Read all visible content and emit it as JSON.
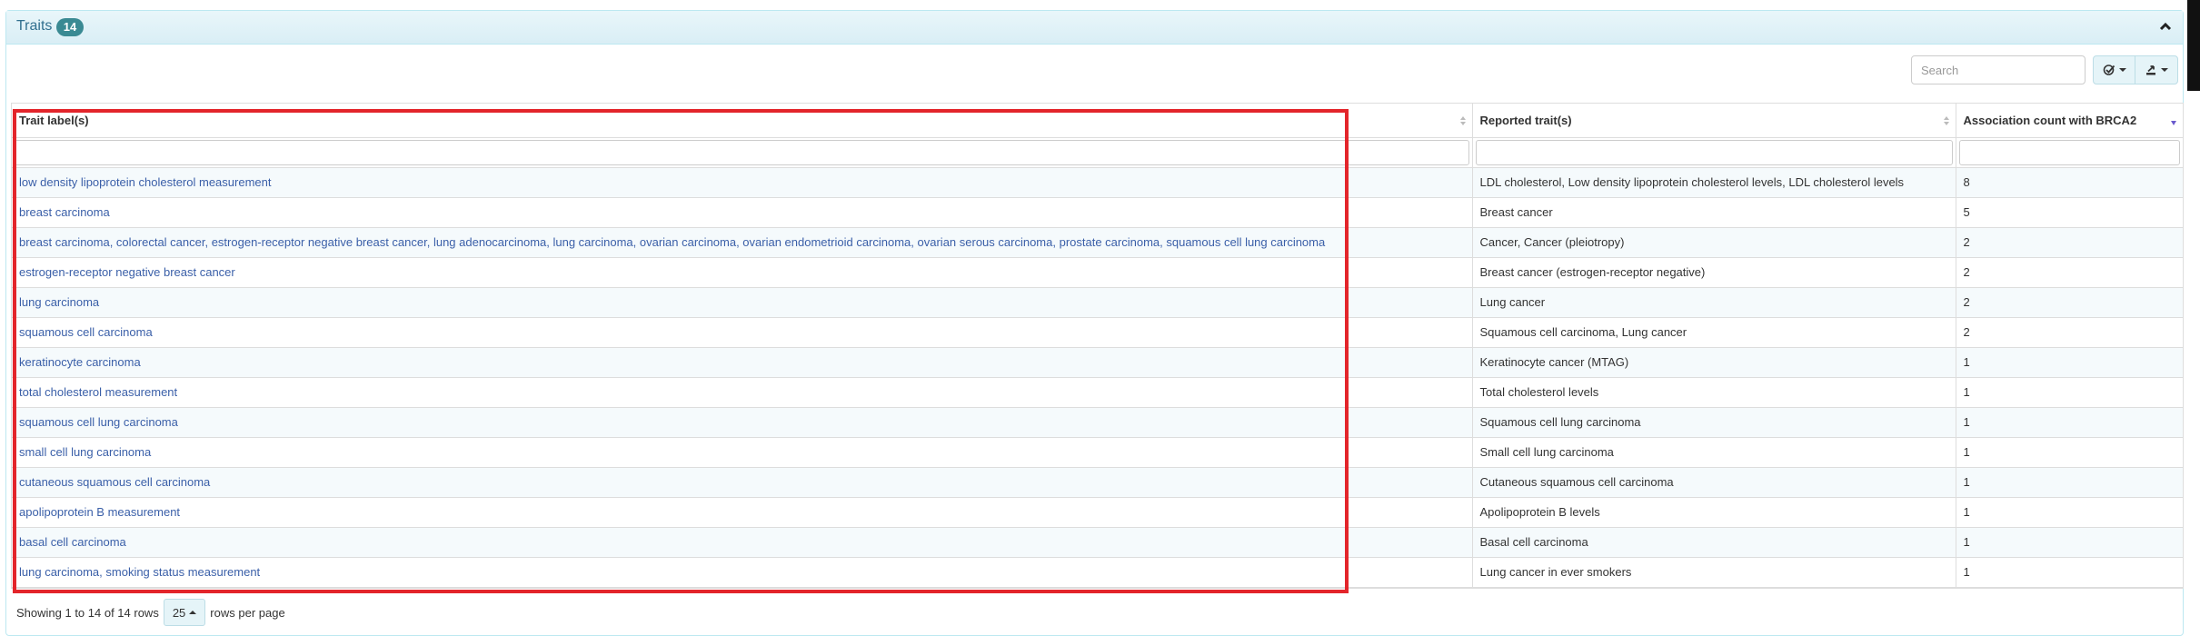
{
  "panel": {
    "title": "Traits",
    "count_badge": "14"
  },
  "toolbar": {
    "search_placeholder": "Search",
    "columns_icon": "columns-toggle-icon",
    "export_icon": "export-icon"
  },
  "table": {
    "columns": [
      "Trait label(s)",
      "Reported trait(s)",
      "Association count with BRCA2"
    ],
    "rows": [
      {
        "trait": "low density lipoprotein cholesterol measurement",
        "reported": "LDL cholesterol, Low density lipoprotein cholesterol levels, LDL cholesterol levels",
        "count": "8"
      },
      {
        "trait": "breast carcinoma",
        "reported": "Breast cancer",
        "count": "5"
      },
      {
        "trait": "breast carcinoma, colorectal cancer, estrogen-receptor negative breast cancer, lung adenocarcinoma, lung carcinoma, ovarian carcinoma, ovarian endometrioid carcinoma, ovarian serous carcinoma, prostate carcinoma, squamous cell lung carcinoma",
        "reported": "Cancer, Cancer (pleiotropy)",
        "count": "2"
      },
      {
        "trait": "estrogen-receptor negative breast cancer",
        "reported": "Breast cancer (estrogen-receptor negative)",
        "count": "2"
      },
      {
        "trait": "lung carcinoma",
        "reported": "Lung cancer",
        "count": "2"
      },
      {
        "trait": "squamous cell carcinoma",
        "reported": "Squamous cell carcinoma, Lung cancer",
        "count": "2"
      },
      {
        "trait": "keratinocyte carcinoma",
        "reported": "Keratinocyte cancer (MTAG)",
        "count": "1"
      },
      {
        "trait": "total cholesterol measurement",
        "reported": "Total cholesterol levels",
        "count": "1"
      },
      {
        "trait": "squamous cell lung carcinoma",
        "reported": "Squamous cell lung carcinoma",
        "count": "1"
      },
      {
        "trait": "small cell lung carcinoma",
        "reported": "Small cell lung carcinoma",
        "count": "1"
      },
      {
        "trait": "cutaneous squamous cell carcinoma",
        "reported": "Cutaneous squamous cell carcinoma",
        "count": "1"
      },
      {
        "trait": "apolipoprotein B measurement",
        "reported": "Apolipoprotein B levels",
        "count": "1"
      },
      {
        "trait": "basal cell carcinoma",
        "reported": "Basal cell carcinoma",
        "count": "1"
      },
      {
        "trait": "lung carcinoma, smoking status measurement",
        "reported": "Lung cancer in ever smokers",
        "count": "1"
      }
    ]
  },
  "pagination": {
    "showing_text": "Showing 1 to 14 of 14 rows",
    "page_size": "25",
    "rows_per_page_text": "rows per page"
  },
  "colors": {
    "link": "#3a5fa8",
    "highlight": "#e3252b",
    "badge": "#3a8a93",
    "heading_bg": "#d9eef5"
  }
}
